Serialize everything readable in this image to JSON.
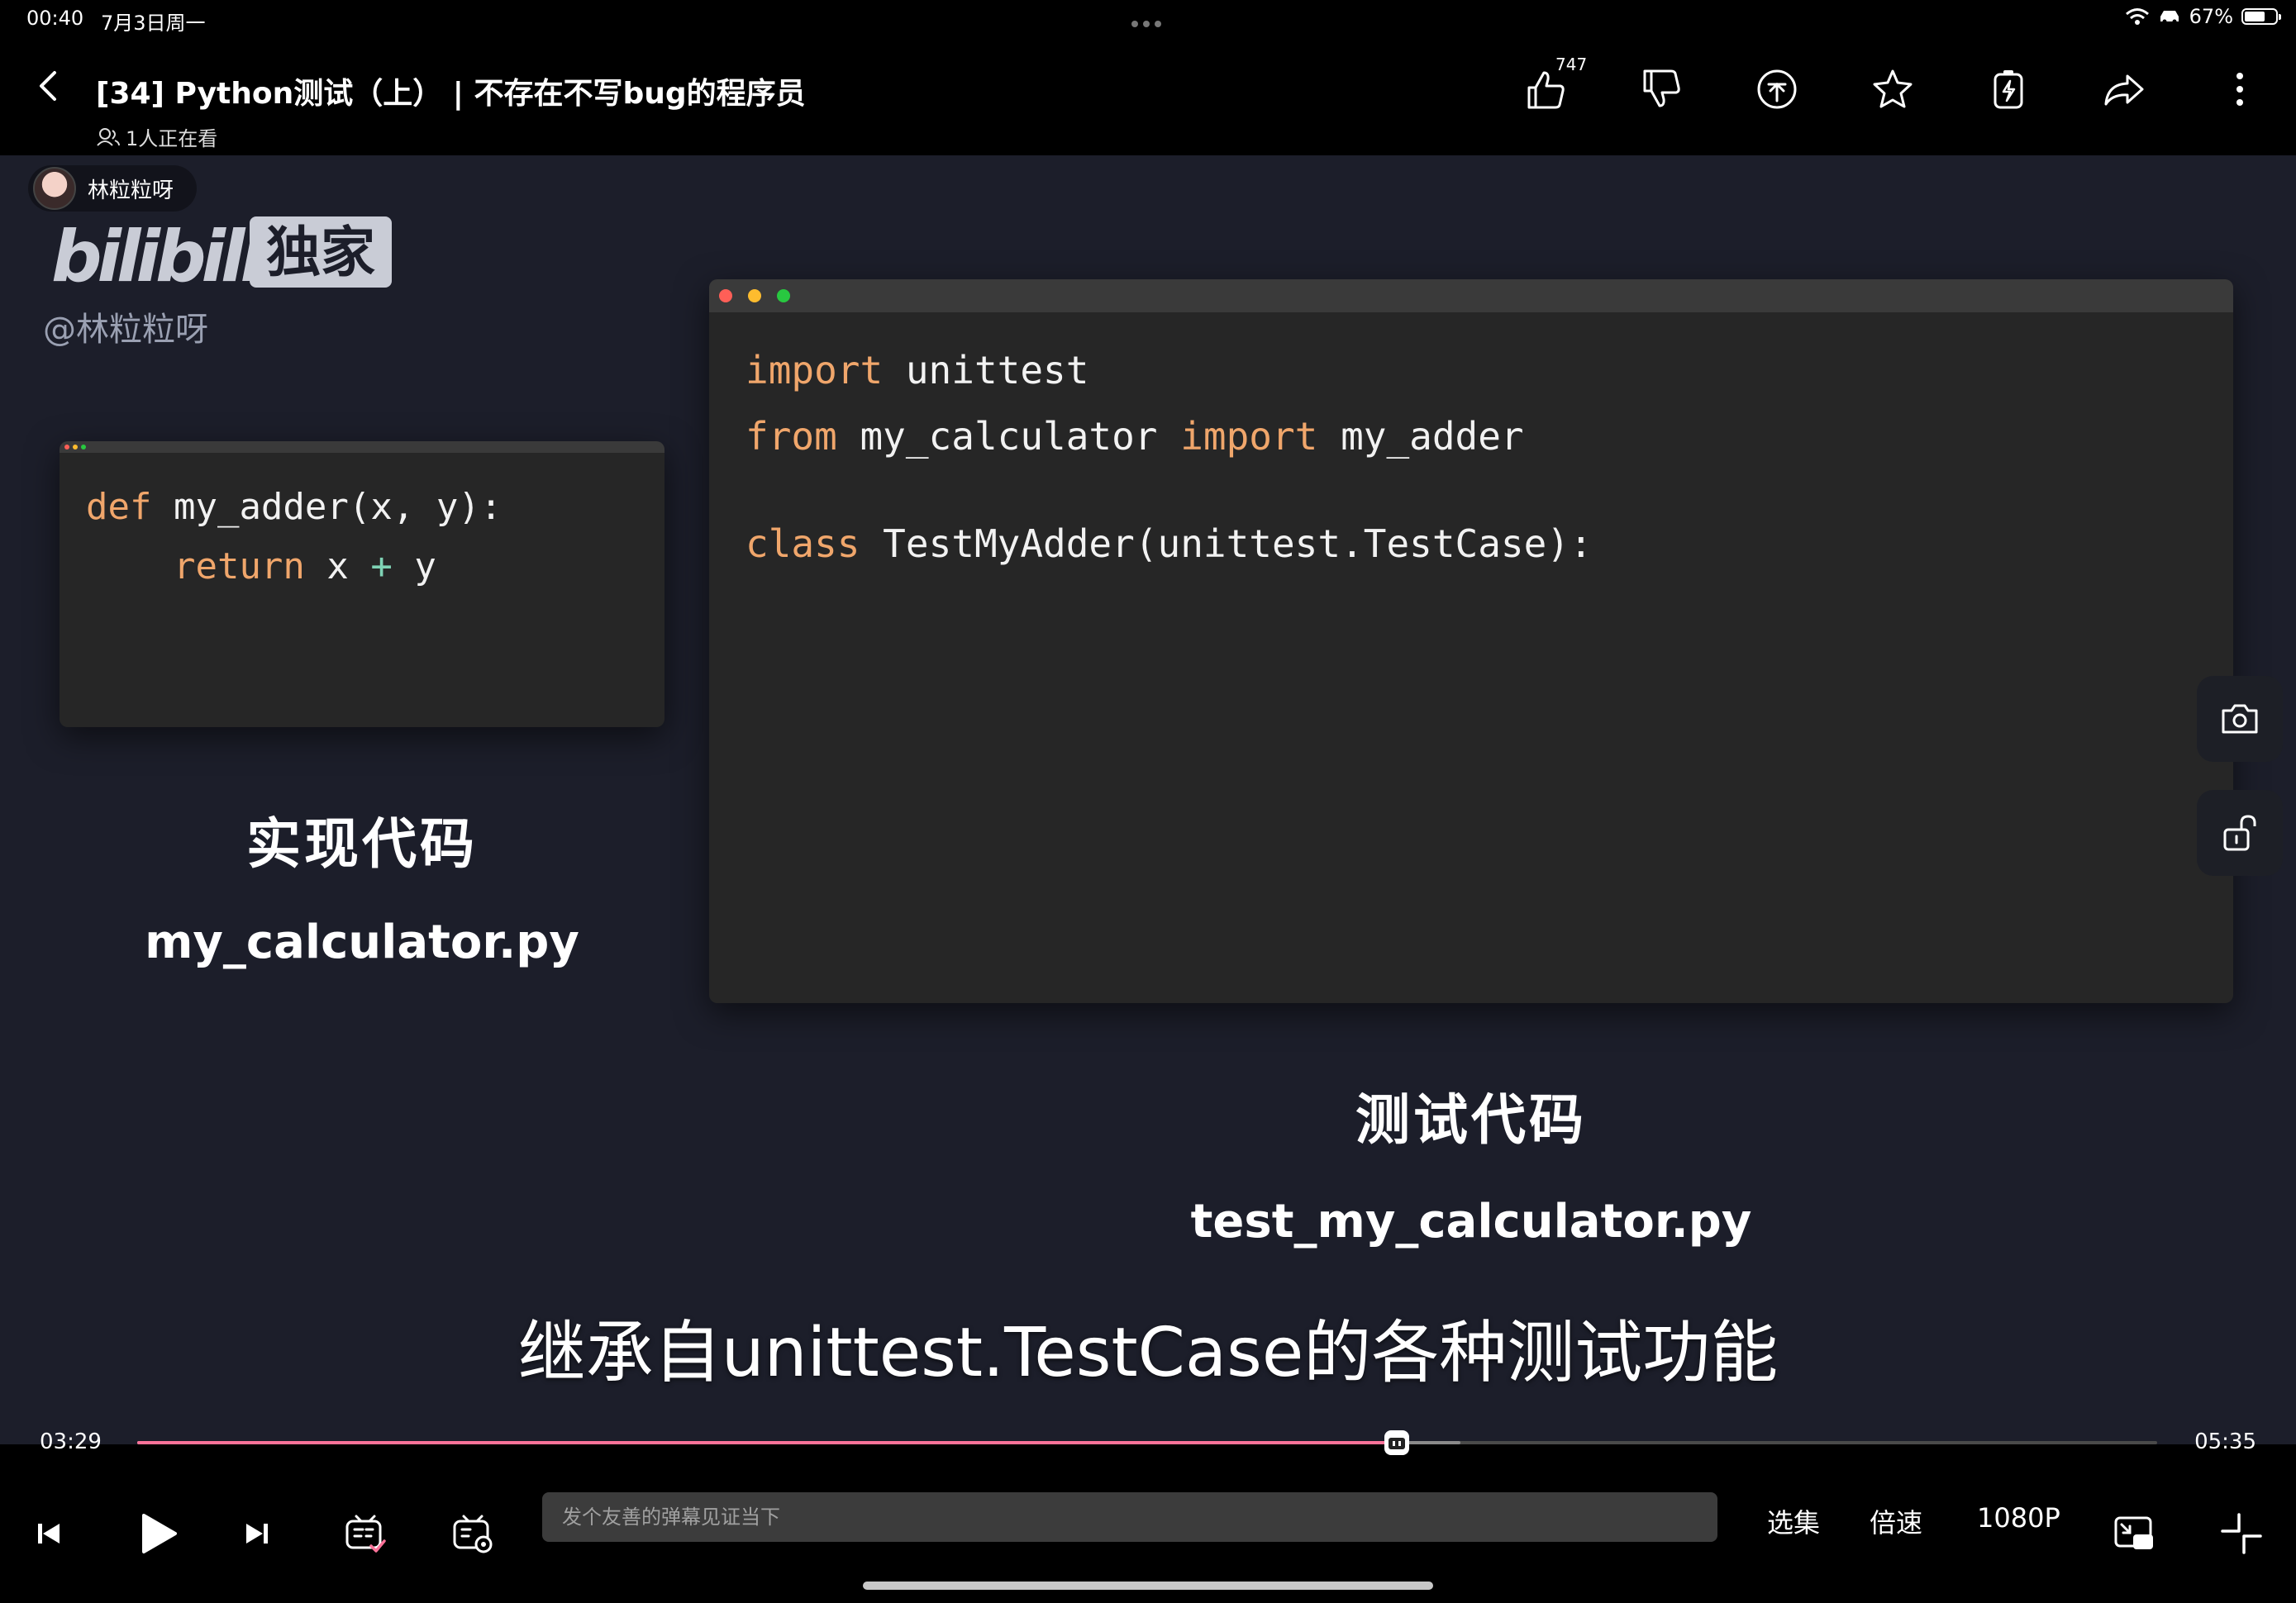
{
  "status_bar": {
    "time": "00:40",
    "date": "7月3日周一",
    "battery_text": "67%",
    "battery_level": 0.67,
    "icons": [
      "wifi-icon",
      "car-icon",
      "battery-icon"
    ]
  },
  "header": {
    "title": "[34] Python测试（上） | 不存在不写bug的程序员",
    "viewers": "1人正在看",
    "like_count": "747",
    "actions": [
      "like-icon",
      "dislike-icon",
      "coin-icon",
      "favorite-icon",
      "charge-icon",
      "share-icon",
      "more-icon"
    ]
  },
  "video": {
    "uploader": "林粒粒呀",
    "watermark_handle": "@林粒粒呀",
    "logo_brand": "bilibili",
    "logo_badge": "独家",
    "left_code_lines": [
      {
        "kw": "def",
        "rest": " my_adder(x, y):"
      }
    ],
    "left_code_line2": {
      "indent": "    ",
      "kw": "return",
      "a": " x ",
      "op": "+",
      "b": " y"
    },
    "right_code": {
      "l1_kw": "import",
      "l1_rest": " unittest",
      "l2_kw": "from",
      "l2_mid": " my_calculator ",
      "l2_kw2": "import",
      "l2_rest": " my_adder",
      "l3_kw": "class",
      "l3_rest": " TestMyAdder(unittest.TestCase):"
    },
    "left_heading": "实现代码",
    "left_filename": "my_calculator.py",
    "right_heading": "测试代码",
    "right_filename": "test_my_calculator.py",
    "subtitle": "继承自unittest.TestCase的各种测试功能",
    "window_dot_colors": [
      "#ff5f57",
      "#febc2e",
      "#28c840"
    ],
    "side_buttons": [
      "camera-icon",
      "lock-icon"
    ]
  },
  "player": {
    "current_time": "03:29",
    "total_time": "05:35",
    "played_fraction": 0.6235,
    "buffered_fraction": 0.655,
    "accent_color": "#fb7299",
    "danmaku_placeholder": "发个友善的弹幕见证当下",
    "episodes_label": "选集",
    "speed_label": "倍速",
    "quality_label": "1080P"
  }
}
